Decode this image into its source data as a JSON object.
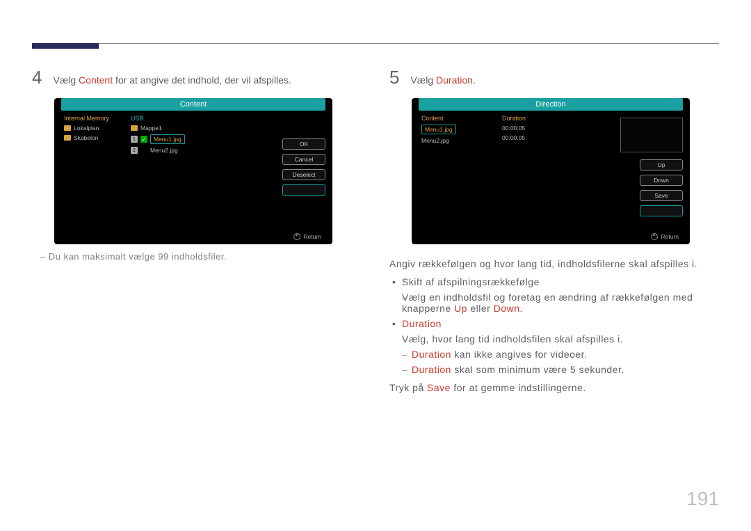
{
  "page_number": "191",
  "left": {
    "step_num": "4",
    "step_prefix": "Vælg ",
    "step_keyword": "Content",
    "step_suffix": " for at angive det indhold, der vil afspilles.",
    "note": "Du kan maksimalt vælge 99 indholdsfiler.",
    "mock": {
      "title": "Content",
      "col_internal": "Internal Memory",
      "col_usb": "USB",
      "rows_left": [
        "Lokalplan",
        "Skabelon"
      ],
      "mappe": "Mappe1",
      "sel_row": "Menu1.jpg",
      "row2": "Menu2.jpg",
      "badge1": "1",
      "badge2": "2",
      "btn_ok": "OK",
      "btn_cancel": "Cancel",
      "btn_deselect": "Deselect",
      "return": "Return"
    }
  },
  "right": {
    "step_num": "5",
    "step_prefix": "Vælg ",
    "step_keyword": "Duration",
    "step_suffix": ".",
    "mock": {
      "title": "Direction",
      "col_content": "Content",
      "col_duration": "Duration",
      "row1_name": "Menu1.jpg",
      "row1_dur": "00:00:05",
      "row2_name": "Menu2.jpg",
      "row2_dur": "00:00:05",
      "btn_up": "Up",
      "btn_down": "Down",
      "btn_save": "Save",
      "btn_hl": "",
      "return": "Return"
    },
    "intro": "Angiv rækkefølgen og hvor lang tid, indholdsfilerne skal afspilles i.",
    "b1_title": "Skift af afspilningsrækkefølge",
    "b1_text_pre": "Vælg en indholdsfil og foretag en ændring af rækkefølgen med knapperne ",
    "b1_up": "Up",
    "b1_or": " eller ",
    "b1_down": "Down",
    "b1_end": ".",
    "b2_title": "Duration",
    "b2_text": "Vælg, hvor lang tid indholdsfilen skal afspilles i.",
    "sub1_kw": "Duration",
    "sub1_rest": " kan ikke angives for videoer.",
    "sub2_kw": "Duration",
    "sub2_rest": " skal som minimum være 5 sekunder.",
    "final_pre": "Tryk på ",
    "final_kw": "Save",
    "final_post": " for at gemme indstillingerne."
  }
}
